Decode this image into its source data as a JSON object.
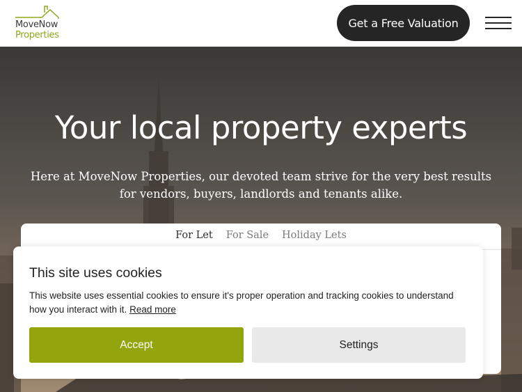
{
  "brand": {
    "name_line1": "MoveNow",
    "name_line2": "Properties",
    "accent_color": "#8fa51a"
  },
  "header": {
    "cta_label": "Get a Free Valuation",
    "menu_icon": "hamburger-menu-icon"
  },
  "hero": {
    "title": "Your local property experts",
    "text": "Here at MoveNow Properties, our devoted team strive for the very best results for vendors, buyers, landlords and tenants alike."
  },
  "search_tabs": {
    "items": [
      {
        "label": "For Let",
        "active": true
      },
      {
        "label": "For Sale",
        "active": false
      },
      {
        "label": "Holiday Lets",
        "active": false
      }
    ]
  },
  "cookie_banner": {
    "title": "This site uses cookies",
    "body": "This website uses essential cookies to ensure it's proper operation and tracking cookies to understand how you interact with it. ",
    "link_label": "Read more",
    "accept_label": "Accept",
    "settings_label": "Settings",
    "accept_color": "#94a40d"
  }
}
